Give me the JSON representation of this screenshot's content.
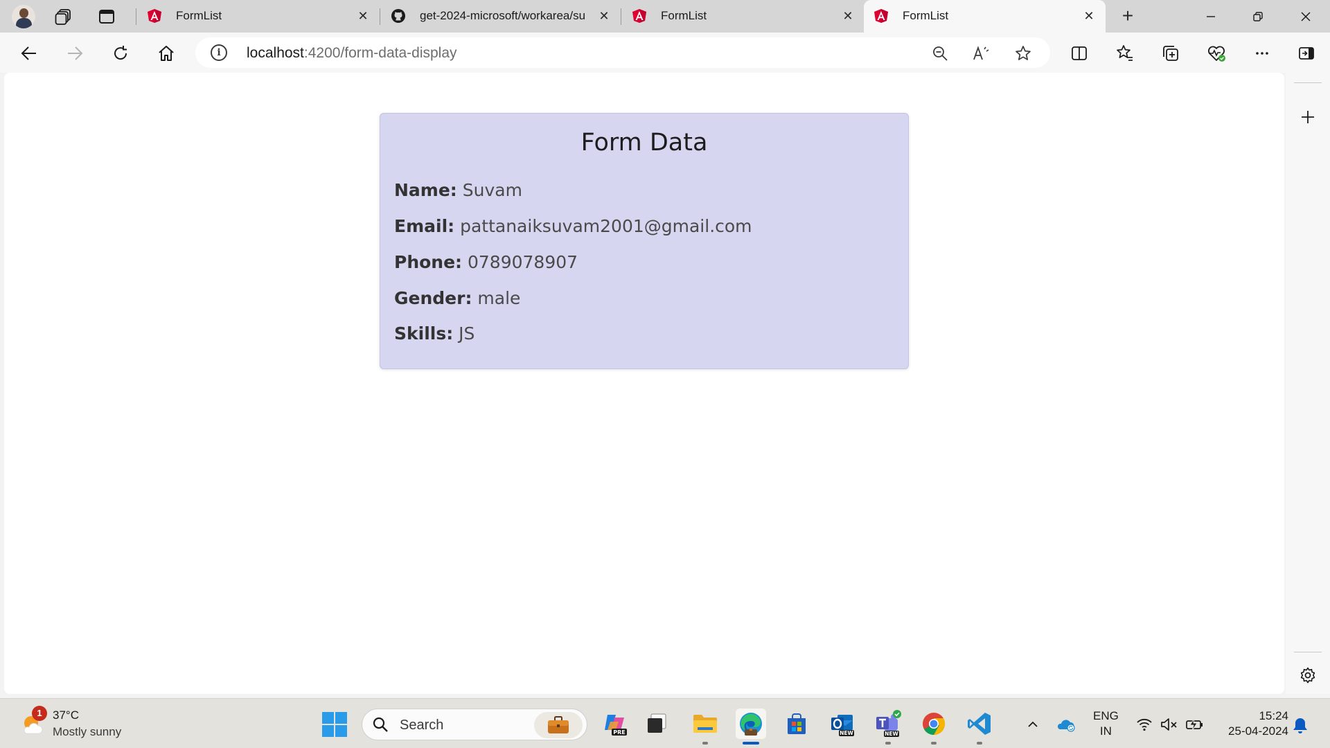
{
  "browser": {
    "tabs": [
      {
        "title": "FormList"
      },
      {
        "title": "get-2024-microsoft/workarea/su"
      },
      {
        "title": "FormList"
      },
      {
        "title": "FormList"
      }
    ],
    "active_tab_index": 3,
    "address": {
      "host": "localhost",
      "path": ":4200/form-data-display"
    }
  },
  "form_data": {
    "heading": "Form Data",
    "fields": [
      {
        "label": "Name:",
        "value": "Suvam"
      },
      {
        "label": "Email:",
        "value": "pattanaiksuvam2001@gmail.com"
      },
      {
        "label": "Phone:",
        "value": "0789078907"
      },
      {
        "label": "Gender:",
        "value": "male"
      },
      {
        "label": "Skills:",
        "value": "JS"
      }
    ]
  },
  "taskbar": {
    "weather": {
      "temp": "37°C",
      "condition": "Mostly sunny",
      "badge": "1"
    },
    "search_placeholder": "Search",
    "language": {
      "line1": "ENG",
      "line2": "IN"
    },
    "clock": {
      "time": "15:24",
      "date": "25-04-2024"
    }
  },
  "colors": {
    "card_bg": "#d6d6f1",
    "angular_red": "#dd0031",
    "edge_blue": "#0a5ac2",
    "accent_blue": "#0078d4"
  }
}
